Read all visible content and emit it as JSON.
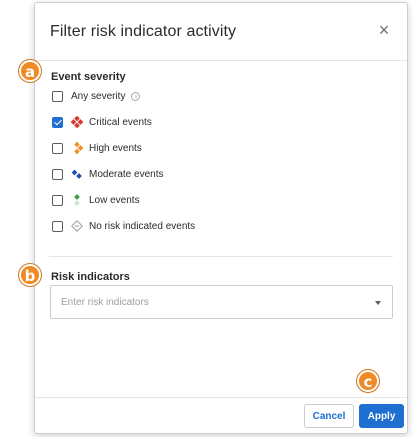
{
  "dialog": {
    "title": "Filter  risk indicator activity",
    "close_glyph": "×"
  },
  "event_severity": {
    "label": "Event severity",
    "options": [
      {
        "label": "Any severity",
        "checked": false,
        "icon": "info-icon"
      },
      {
        "label": "Critical events",
        "checked": true,
        "icon": "critical-severity-icon",
        "color": "#d9382c"
      },
      {
        "label": "High events",
        "checked": false,
        "icon": "high-severity-icon",
        "color": "#f0922b"
      },
      {
        "label": "Moderate events",
        "checked": false,
        "icon": "moderate-severity-icon",
        "color": "#1f4ea8"
      },
      {
        "label": "Low events",
        "checked": false,
        "icon": "low-severity-icon",
        "color": "#3a9a4a"
      },
      {
        "label": "No risk indicated events",
        "checked": false,
        "icon": "no-risk-icon",
        "color": "#9aa0a6"
      }
    ]
  },
  "risk_indicators": {
    "label": "Risk indicators",
    "placeholder": "Enter risk indicators"
  },
  "footer": {
    "cancel_label": "Cancel",
    "apply_label": "Apply"
  },
  "markers": {
    "a": "a",
    "b": "b",
    "c": "c"
  },
  "colors": {
    "accent": "#1f6fd0",
    "marker": "#f08a24"
  }
}
